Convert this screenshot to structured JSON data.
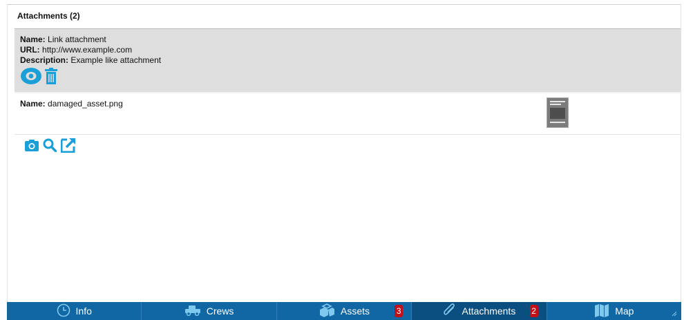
{
  "section": {
    "title": "Attachments (2)"
  },
  "attachments": [
    {
      "name_label": "Name:",
      "name": "Link attachment",
      "url_label": "URL:",
      "url": "http://www.example.com",
      "description_label": "Description:",
      "description": "Example like attachment",
      "actions": [
        "eye-icon",
        "trash-icon"
      ]
    },
    {
      "name_label": "Name:",
      "name": "damaged_asset.png",
      "thumbnail": "image-thumbnail"
    }
  ],
  "toolbar": {
    "icons": [
      "camera-icon",
      "search-icon",
      "external-link-icon"
    ]
  },
  "nav": {
    "tabs": [
      {
        "label": "Info",
        "icon": "clock-icon"
      },
      {
        "label": "Crews",
        "icon": "truck-icon"
      },
      {
        "label": "Assets",
        "icon": "cubes-icon",
        "badge": "3"
      },
      {
        "label": "Attachments",
        "icon": "paperclip-icon",
        "badge": "2",
        "active": true
      },
      {
        "label": "Map",
        "icon": "map-icon"
      }
    ]
  },
  "colors": {
    "accent": "#1a9fd6",
    "nav_bg": "#1067a3",
    "nav_active": "#0a4f80",
    "badge": "#c0101a",
    "selected_row": "#dedede"
  }
}
